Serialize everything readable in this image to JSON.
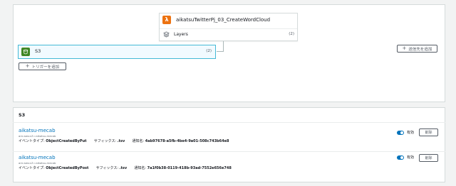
{
  "designer": {
    "function": {
      "name": "aikatsuTwitterPj_03_CreateWordCloud",
      "icon": "lambda-icon",
      "layers_label": "Layers",
      "layers_count": "(2)"
    },
    "trigger": {
      "name": "S3",
      "count": "(2)",
      "icon": "s3-bucket-icon"
    },
    "add_trigger_label": "トリガーを追加",
    "add_destination_label": "送信先を追加"
  },
  "triggers_section": {
    "title": "S3",
    "items": [
      {
        "bucket": "aikatsu-mecab",
        "arn": "arn:aws:s3:::aikatsu-mecab",
        "event_type_label": "イベントタイプ:",
        "event_type": "ObjectCreatedByPut",
        "suffix_label": "サフィックス:",
        "suffix": ".tsv",
        "notification_label": "通知名:",
        "notification": "4ab97678-a5fb-4be4-9a01-508c743b64e8",
        "enabled_label": "有効",
        "delete_label": "削除"
      },
      {
        "bucket": "aikatsu-mecab",
        "arn": "arn:aws:s3:::aikatsu-mecab",
        "event_type_label": "イベントタイプ:",
        "event_type": "ObjectCreatedByPost",
        "suffix_label": "サフィックス:",
        "suffix": ".tsv",
        "notification_label": "通知名:",
        "notification": "7a1f0b38-0119-418b-93ad-7552e656e748",
        "enabled_label": "有効",
        "delete_label": "削除"
      }
    ]
  },
  "colors": {
    "lambda_orange": "#ec7211",
    "s3_green": "#3f8624",
    "link_blue": "#0073bb",
    "selected_border": "#44b9d6"
  }
}
